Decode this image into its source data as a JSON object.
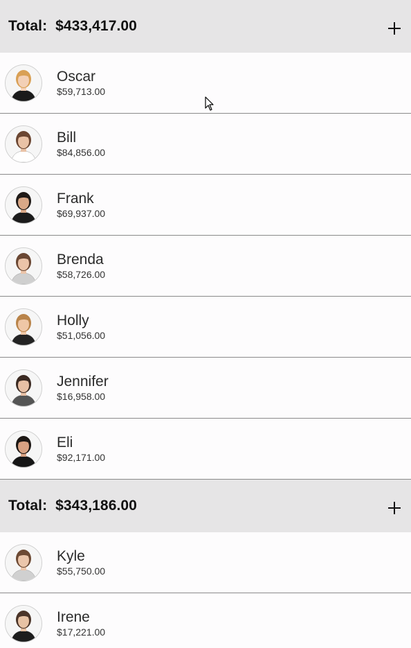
{
  "groups": [
    {
      "total_label": "Total:",
      "total_value": "$433,417.00",
      "add_icon": "plus-icon",
      "people": [
        {
          "name": "Oscar",
          "amount": "$59,713.00",
          "hair": "#d9a055",
          "skin": "#f3d0b6",
          "suit": "#1a1a1a"
        },
        {
          "name": "Bill",
          "amount": "$84,856.00",
          "hair": "#6b4632",
          "skin": "#e9c2a6",
          "suit": "#ffffff"
        },
        {
          "name": "Frank",
          "amount": "$69,937.00",
          "hair": "#1f1a17",
          "skin": "#d9a887",
          "suit": "#1b1b1b"
        },
        {
          "name": "Brenda",
          "amount": "$58,726.00",
          "hair": "#6a4733",
          "skin": "#ebc4a9",
          "suit": "#cfcfcf"
        },
        {
          "name": "Holly",
          "amount": "$51,056.00",
          "hair": "#b9844a",
          "skin": "#efc7a6",
          "suit": "#232323"
        },
        {
          "name": "Jennifer",
          "amount": "$16,958.00",
          "hair": "#3b2a22",
          "skin": "#e8c0a5",
          "suit": "#555555"
        },
        {
          "name": "Eli",
          "amount": "$92,171.00",
          "hair": "#1c1714",
          "skin": "#d8a283",
          "suit": "#161616"
        }
      ]
    },
    {
      "total_label": "Total:",
      "total_value": "$343,186.00",
      "add_icon": "plus-icon",
      "people": [
        {
          "name": "Kyle",
          "amount": "$55,750.00",
          "hair": "#6d4a34",
          "skin": "#ebc6ab",
          "suit": "#d0d0d0"
        },
        {
          "name": "Irene",
          "amount": "$17,221.00",
          "hair": "#4a3428",
          "skin": "#e7c2a4",
          "suit": "#1d1d1d"
        }
      ]
    }
  ],
  "cursor_icon": "mouse-pointer-icon"
}
